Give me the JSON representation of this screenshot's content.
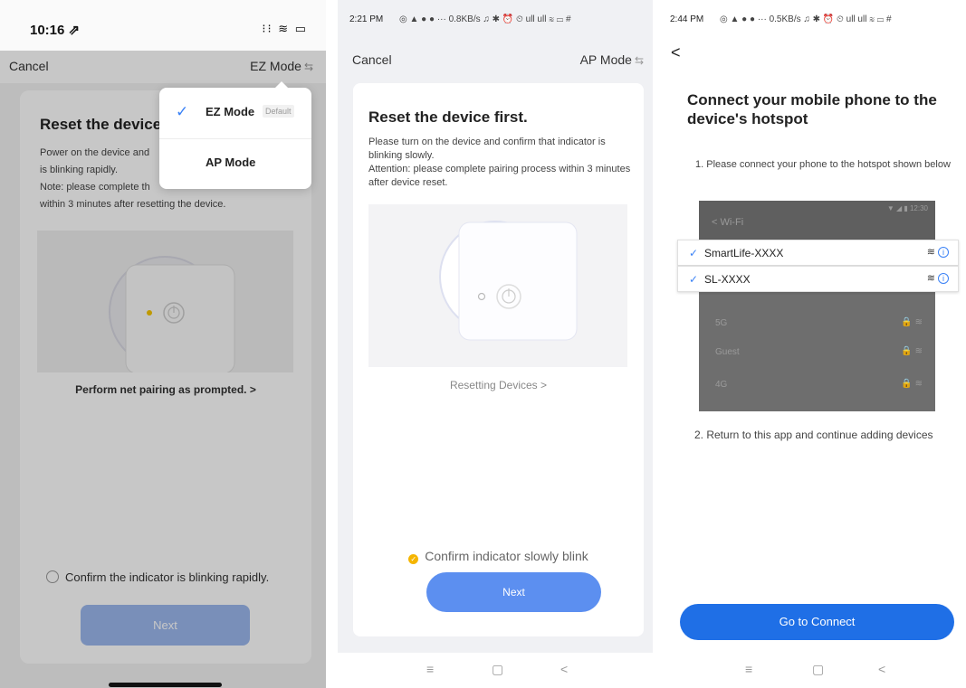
{
  "panel1": {
    "status_time": "10:16 ⇗",
    "status_icons": "⁝⁝ ≋ ▭",
    "cancel": "Cancel",
    "mode_label": "EZ Mode",
    "mode_arrows": "⇆",
    "title": "Reset the device",
    "desc_lines": [
      "Power on the device and",
      "is blinking rapidly.",
      "Note: please complete th",
      "within 3 minutes after resetting the device."
    ],
    "link": "Perform net pairing as prompted. >",
    "confirm": "Confirm the indicator is blinking rapidly.",
    "next": "Next",
    "menu": {
      "items": [
        {
          "label": "EZ Mode",
          "badge": "Default",
          "checked": true
        },
        {
          "label": "AP Mode",
          "badge": "",
          "checked": false
        }
      ],
      "check_icon": "✓"
    }
  },
  "panel2": {
    "status_time": "2:21 PM",
    "status_icons": "◎ ▲ ● ● ··· 0.8KB/s ♫ ✱ ⏰ ⏲ ull ull ≋ ▭ #",
    "cancel": "Cancel",
    "mode_label": "AP Mode",
    "mode_arrows": "⇆",
    "title": "Reset the device first.",
    "desc": "Please turn on the device and confirm that indicator is blinking slowly.\nAttention: please complete pairing process within 3 minutes after device reset.",
    "link": "Resetting Devices >",
    "confirm": "Confirm indicator slowly blink",
    "next": "Next",
    "nav_buttons": [
      "≡",
      "▢",
      "<"
    ]
  },
  "panel3": {
    "status_time": "2:44 PM",
    "status_icons": "◎ ▲ ● ● ··· 0.5KB/s ♫ ✱ ⏰ ⏲ ull ull ≋ ▭ #",
    "back": "<",
    "title": "Connect your mobile phone to the device's hotspot",
    "step1": "1. Please connect your phone to the hotspot shown below",
    "phone": {
      "header": "< Wi-Fi",
      "time": "▼ ◢ ▮ 12:30",
      "rows": [
        "5G",
        "Guest",
        "4G"
      ]
    },
    "networks": [
      "SmartLife-XXXX",
      "SL-XXXX"
    ],
    "check_icon": "✓",
    "step2": "2. Return to this app and continue adding devices",
    "go": "Go to Connect",
    "nav_buttons": [
      "≡",
      "▢",
      "<"
    ]
  },
  "colors": {
    "primary_blue": "#5c8ff0",
    "go_blue": "#1f6fe6",
    "disabled_blue": "#9cb8ee",
    "indicator_yellow": "#f5b500"
  }
}
